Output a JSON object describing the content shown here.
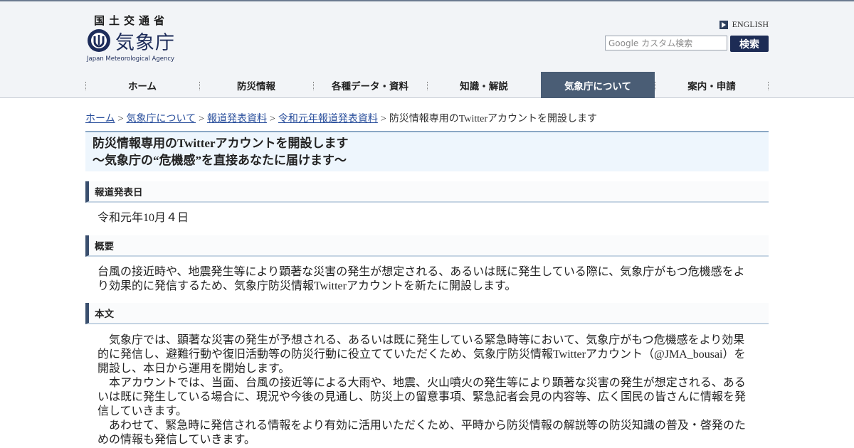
{
  "header": {
    "ministry": "国土交通省",
    "agency_name": "気象庁",
    "agency_en": "Japan Meteorological Agency",
    "english_link": "ENGLISH",
    "search_placeholder": "Google カスタム検索",
    "search_button": "検索"
  },
  "nav": {
    "items": [
      {
        "label": "ホーム"
      },
      {
        "label": "防災情報"
      },
      {
        "label": "各種データ・資料"
      },
      {
        "label": "知識・解説"
      },
      {
        "label": "気象庁について",
        "active": true
      },
      {
        "label": "案内・申請"
      }
    ]
  },
  "breadcrumb": {
    "items": [
      "ホーム",
      "気象庁について",
      "報道発表資料",
      "令和元年報道発表資料"
    ],
    "current": "防災情報専用のTwitterアカウントを開設します",
    "separator": ">"
  },
  "article": {
    "title_line1": "防災情報専用のTwitterアカウントを開設します",
    "title_line2": "～気象庁の“危機感”を直接あなたに届けます～",
    "sections": {
      "date": {
        "heading": "報道発表日",
        "text": "令和元年10月４日"
      },
      "summary": {
        "heading": "概要",
        "text": "台風の接近時や、地震発生等により顕著な災害の発生が想定される、あるいは既に発生している際に、気象庁がもつ危機感をより効果的に発信するため、気象庁防災情報Twitterアカウントを新たに開設します。"
      },
      "body": {
        "heading": "本文",
        "paragraphs": [
          "気象庁では、顕著な災害の発生が予想される、あるいは既に発生している緊急時等において、気象庁がもつ危機感をより効果的に発信し、避難行動や復旧活動等の防災行動に役立てていただくため、気象庁防災情報Twitterアカウント（@JMA_bousai）を開設し、本日から運用を開始します。",
          "本アカウントでは、当面、台風の接近等による大雨や、地震、火山噴火の発生等により顕著な災害の発生が想定される、あるいは既に発生している場合に、現況や今後の見通し、防災上の留意事項、緊急記者会見の内容等、広く国民の皆さんに情報を発信していきます。",
          "あわせて、緊急時に発信される情報をより有効に活用いただくため、平時から防災情報の解説等の防災知識の普及・啓発のための情報も発信していきます。"
        ]
      }
    }
  },
  "colors": {
    "nav_active_bg": "#4a5d75",
    "link": "#2a4f9c",
    "title_bg": "#eef6fd",
    "section_bar": "#3a4f6e",
    "search_button_bg": "#1d2c55"
  }
}
